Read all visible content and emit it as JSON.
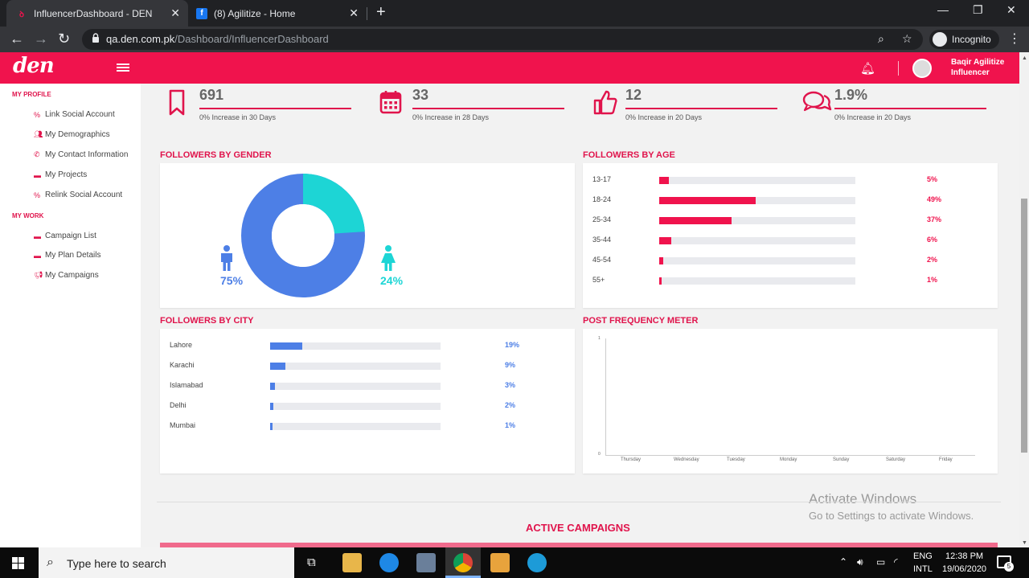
{
  "browser": {
    "tabs": [
      {
        "title": "InfluencerDashboard - DEN",
        "favicon": "den-logo"
      },
      {
        "title": "(8) Agilitize - Home",
        "favicon": "facebook-icon"
      }
    ],
    "url_host": "qa.den.com.pk",
    "url_path": "/Dashboard/InfluencerDashboard",
    "profile": "Incognito"
  },
  "app": {
    "logo": "den",
    "user_name_line1": "Baqir Agilitize",
    "user_name_line2": "Influencer",
    "accent": "#f0134d"
  },
  "sidebar": {
    "profile_heading": "MY PROFILE",
    "profile_items": [
      {
        "label": "Link Social Account",
        "icon": "link-icon"
      },
      {
        "label": "My Demographics",
        "icon": "users-icon"
      },
      {
        "label": "My Contact Information",
        "icon": "phone-icon"
      },
      {
        "label": "My Projects",
        "icon": "briefcase-icon"
      },
      {
        "label": "Relink Social Account",
        "icon": "link-icon"
      }
    ],
    "work_heading": "MY WORK",
    "work_items": [
      {
        "label": "Campaign List",
        "icon": "briefcase-icon"
      },
      {
        "label": "My Plan Details",
        "icon": "briefcase-icon"
      },
      {
        "label": "My Campaigns",
        "icon": "bullhorn-icon"
      }
    ]
  },
  "stats": [
    {
      "value": "691",
      "caption": "0% Increase in 30 Days",
      "icon": "bookmark-icon"
    },
    {
      "value": "33",
      "caption": "0% Increase in 28 Days",
      "icon": "calendar-icon"
    },
    {
      "value": "12",
      "caption": "0% Increase in 20 Days",
      "icon": "thumbs-up-icon"
    },
    {
      "value": "1.9%",
      "caption": "0% Increase in 20 Days",
      "icon": "comments-icon"
    }
  ],
  "gender": {
    "title": "FOLLOWERS BY GENDER",
    "male_pct": "75%",
    "female_pct": "24%",
    "male_color": "#4d7fe6",
    "female_color": "#1dd5d5"
  },
  "age": {
    "title": "FOLLOWERS BY AGE",
    "color": "#f0134d",
    "rows": [
      {
        "label": "13-17",
        "pct": "5%",
        "value": 5
      },
      {
        "label": "18-24",
        "pct": "49%",
        "value": 49
      },
      {
        "label": "25-34",
        "pct": "37%",
        "value": 37
      },
      {
        "label": "35-44",
        "pct": "6%",
        "value": 6
      },
      {
        "label": "45-54",
        "pct": "2%",
        "value": 2
      },
      {
        "label": "55+",
        "pct": "1%",
        "value": 1
      }
    ]
  },
  "city": {
    "title": "FOLLOWERS BY CITY",
    "color": "#4d7fe6",
    "rows": [
      {
        "label": "Lahore",
        "pct": "19%",
        "value": 19
      },
      {
        "label": "Karachi",
        "pct": "9%",
        "value": 9
      },
      {
        "label": "Islamabad",
        "pct": "3%",
        "value": 3
      },
      {
        "label": "Delhi",
        "pct": "2%",
        "value": 2
      },
      {
        "label": "Mumbai",
        "pct": "1%",
        "value": 1
      }
    ]
  },
  "post_freq": {
    "title": "POST FREQUENCY METER",
    "y_top": "1",
    "y_bottom": "0",
    "days": [
      "Thursday",
      "Wednesday",
      "Tuesday",
      "Monday",
      "Sunday",
      "Saturday",
      "Friday"
    ]
  },
  "active_campaigns": "ACTIVE CAMPAIGNS",
  "watermark": {
    "line1": "Activate Windows",
    "line2": "Go to Settings to activate Windows."
  },
  "taskbar": {
    "search_placeholder": "Type here to search",
    "lang_line1": "ENG",
    "lang_line2": "INTL",
    "time": "12:38 PM",
    "date": "19/06/2020",
    "notifications": "5"
  }
}
